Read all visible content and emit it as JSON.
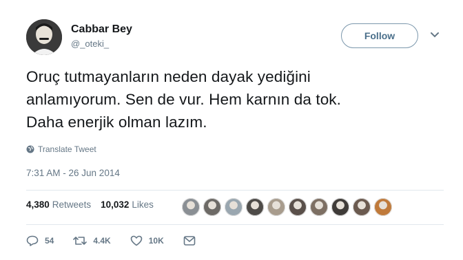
{
  "user": {
    "name": "Cabbar Bey",
    "handle": "@_oteki_"
  },
  "follow_label": "Follow",
  "tweet": {
    "line1": "Oruç tutmayanların neden dayak yediğini",
    "line2": "anlamıyorum. Sen de vur. Hem karnın da tok.",
    "line3": "Daha enerjik olman lazım."
  },
  "translate_label": "Translate Tweet",
  "timestamp": "7:31 AM - 26 Jun 2014",
  "stats": {
    "retweets_count": "4,380",
    "retweets_label": "Retweets",
    "likes_count": "10,032",
    "likes_label": "Likes"
  },
  "liker_colors": [
    "#8a8f94",
    "#6d6a66",
    "#9aa7b0",
    "#4e4b48",
    "#a89c8d",
    "#5a504a",
    "#7d6f63",
    "#3f3b38",
    "#6b5a4f",
    "#c07a3a"
  ],
  "actions": {
    "replies": "54",
    "retweets": "4.4K",
    "likes": "10K"
  },
  "colors": {
    "text": "#14171a",
    "secondary": "#657786",
    "border": "#e1e8ed"
  },
  "icons": [
    "globe-icon",
    "chevron-down-icon",
    "reply-icon",
    "retweet-icon",
    "heart-icon",
    "message-icon"
  ]
}
